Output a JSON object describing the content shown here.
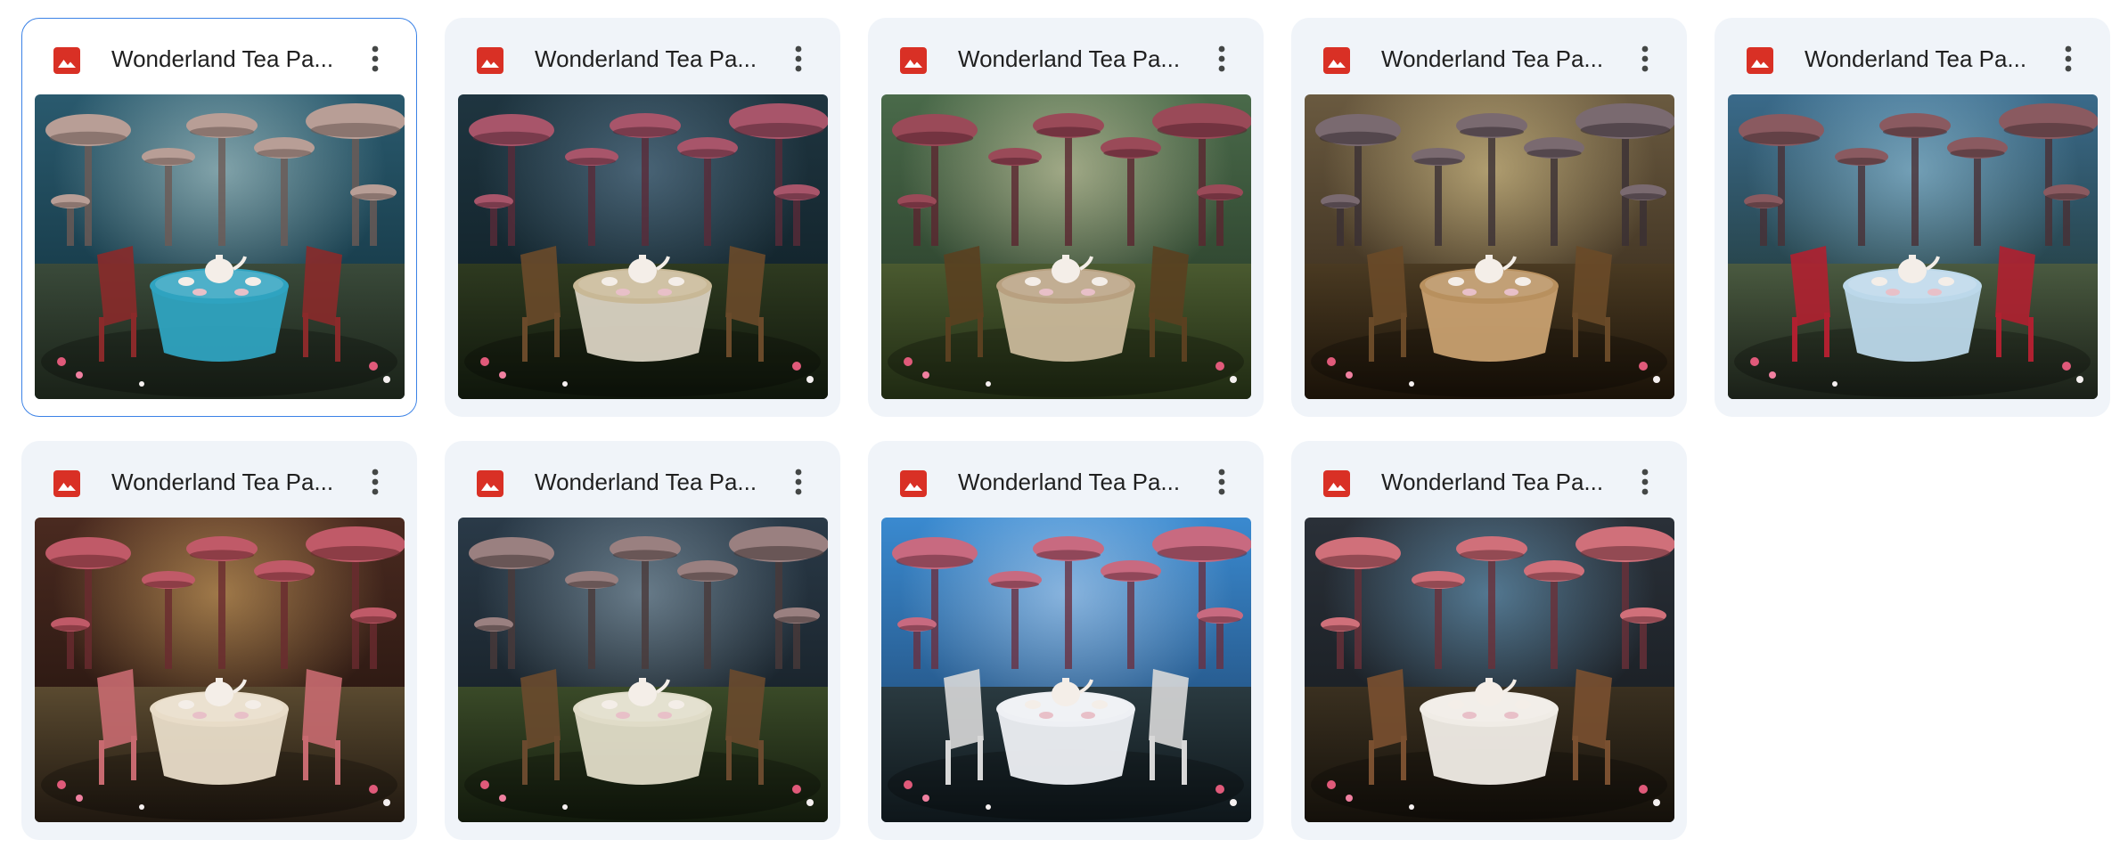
{
  "colors": {
    "selection_border": "#3b82e6",
    "card_background": "#f0f4f9",
    "image_icon": "#d93025",
    "title_text": "#1f1f1f"
  },
  "files": [
    {
      "title": "Wonderland Tea Pa...",
      "icon": "image-file-icon",
      "selected": true,
      "thumbnail": "blue mushroom forest, table with turquoise cloth, red chairs"
    },
    {
      "title": "Wonderland Tea Pa...",
      "icon": "image-file-icon",
      "selected": false,
      "thumbnail": "dark forest with pink mushrooms, teapot on round table"
    },
    {
      "title": "Wonderland Tea Pa...",
      "icon": "image-file-icon",
      "selected": false,
      "thumbnail": "green garden, wooden table with tea cups, chairs"
    },
    {
      "title": "Wonderland Tea Pa...",
      "icon": "image-file-icon",
      "selected": false,
      "thumbnail": "warm sunlit forest, wooden table and windsor chairs"
    },
    {
      "title": "Wonderland Tea Pa...",
      "icon": "image-file-icon",
      "selected": false,
      "thumbnail": "garden arches, white table with tiered teapot, red chair"
    },
    {
      "title": "Wonderland Tea Pa...",
      "icon": "image-file-icon",
      "selected": false,
      "thumbnail": "indoor room with pink mushroom lamps, chandelier, tea table"
    },
    {
      "title": "Wonderland Tea Pa...",
      "icon": "image-file-icon",
      "selected": false,
      "thumbnail": "dark blue mushroom forest, white table with teapot"
    },
    {
      "title": "Wonderland Tea Pa...",
      "icon": "image-file-icon",
      "selected": false,
      "thumbnail": "bright sky, pink mushrooms, white table with pink teapot"
    },
    {
      "title": "Wonderland Tea Pa...",
      "icon": "image-file-icon",
      "selected": false,
      "thumbnail": "stone arches, pink mushrooms, white table with teapot"
    }
  ]
}
